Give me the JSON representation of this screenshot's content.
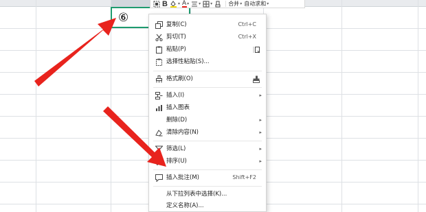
{
  "sheet": {
    "active_cell_value": "⑥",
    "colors": {
      "selection": "#1e9b6e",
      "gridline": "#dde0e4",
      "arrow": "#e8231d"
    }
  },
  "mini_toolbar": {
    "items": [
      {
        "name": "format-painter",
        "icon": "brush-icon"
      },
      {
        "name": "bold",
        "label": "B"
      },
      {
        "name": "fill-color",
        "icon": "fill-icon"
      },
      {
        "name": "font-color",
        "label": "A"
      },
      {
        "name": "align",
        "icon": "align-icon"
      },
      {
        "name": "borders",
        "icon": "border-icon"
      },
      {
        "name": "clear",
        "icon": "eraser-icon"
      }
    ],
    "merge_label": "合并",
    "autosum_label": "自动求和"
  },
  "menu": {
    "items": [
      {
        "label": "复制(C)",
        "shortcut": "Ctrl+C",
        "icon": "copy-icon"
      },
      {
        "label": "剪切(T)",
        "shortcut": "Ctrl+X",
        "icon": "scissors-icon"
      },
      {
        "label": "粘贴(P)",
        "icon": "paste-icon"
      },
      {
        "label": "选择性粘贴(S)...",
        "icon": "paste-special-icon"
      },
      {
        "label": "格式刷(O)",
        "icon": "format-painter-icon"
      },
      {
        "label": "插入(I)",
        "icon": "insert-icon",
        "submenu": true
      },
      {
        "label": "插入图表",
        "icon": "chart-icon"
      },
      {
        "label": "删除(D)",
        "submenu": true
      },
      {
        "label": "清除内容(N)",
        "icon": "clear-icon",
        "submenu": true
      },
      {
        "label": "筛选(L)",
        "icon": "filter-icon",
        "submenu": true
      },
      {
        "label": "排序(U)",
        "icon": "sort-icon",
        "submenu": true
      },
      {
        "label": "插入批注(M)",
        "shortcut": "Shift+F2",
        "icon": "comment-icon"
      },
      {
        "label": "从下拉列表中选择(K)..."
      },
      {
        "label": "定义名称(A)..."
      }
    ]
  }
}
